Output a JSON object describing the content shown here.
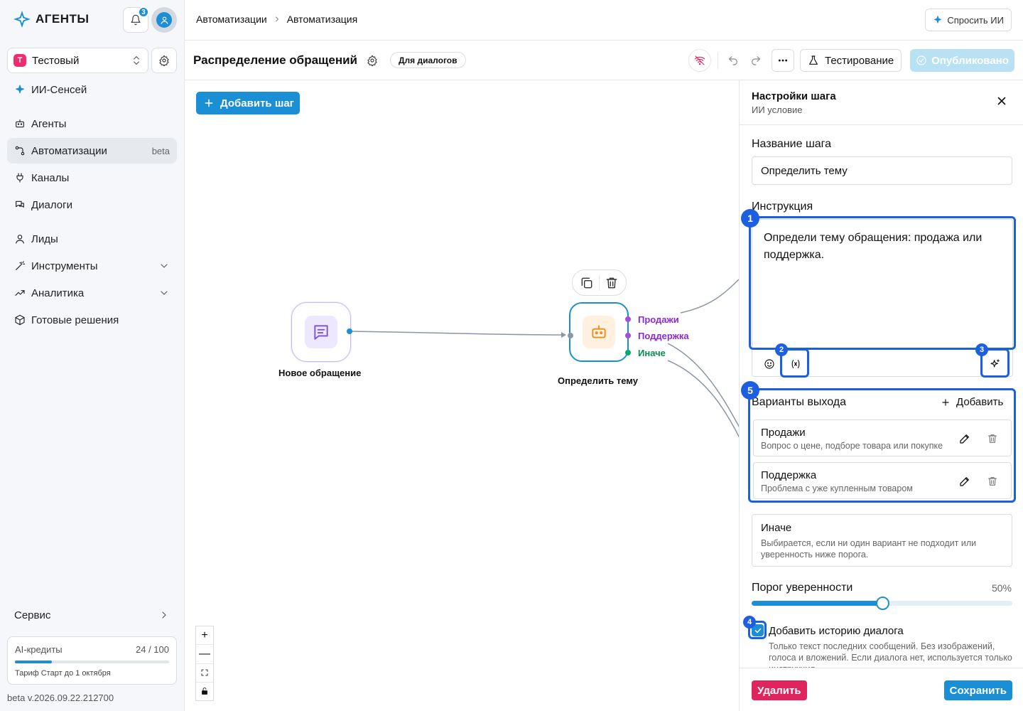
{
  "brand": {
    "name": "АГЕНТЫ",
    "accent": "#1a8fd6"
  },
  "header": {
    "notifications_count": "3"
  },
  "workspace": {
    "letter": "Т",
    "name": "Тестовый"
  },
  "sidebar": {
    "items": [
      {
        "label": "ИИ-Сенсей",
        "icon": "sparkle-icon"
      },
      {
        "label": "Агенты",
        "icon": "bot-icon"
      },
      {
        "label": "Автоматизации",
        "badge": "beta",
        "icon": "workflow-icon",
        "active": true
      },
      {
        "label": "Каналы",
        "icon": "plug-icon"
      },
      {
        "label": "Диалоги",
        "icon": "chats-icon"
      },
      {
        "label": "Лиды",
        "icon": "user-icon"
      },
      {
        "label": "Инструменты",
        "icon": "wand-icon"
      },
      {
        "label": "Аналитика",
        "icon": "chart-icon"
      },
      {
        "label": "Готовые решения",
        "icon": "package-icon"
      }
    ],
    "service": "Сервис",
    "credits": {
      "label": "AI-кредиты",
      "value": "24 / 100",
      "used_fraction": 0.24,
      "plan": "Тариф Старт до 1 октября"
    },
    "version": "beta v.2026.09.22.212700"
  },
  "breadcrumb": {
    "parent": "Автоматизации",
    "current": "Автоматизация"
  },
  "ask_ai": "Спросить ИИ",
  "flow": {
    "title": "Распределение обращений",
    "tag": "Для диалогов",
    "test_label": "Тестирование",
    "publish_label": "Опубликовано"
  },
  "canvas": {
    "add_step": "Добавить шаг",
    "nodes": [
      {
        "label": "Новое обращение",
        "type": "trigger"
      },
      {
        "label": "Определить тему",
        "type": "ai-condition"
      }
    ],
    "outputs": [
      {
        "label": "Продажи",
        "color": "#a64ddb"
      },
      {
        "label": "Поддержка",
        "color": "#a64ddb"
      },
      {
        "label": "Иначе",
        "color": "#0aa86b"
      }
    ]
  },
  "panel": {
    "title": "Настройки шага",
    "subtitle": "ИИ условие",
    "name_label": "Название шага",
    "name_value": "Определить тему",
    "instruction_label": "Инструкция",
    "instruction_value": "Определи тему обращения: продажа или поддержка.",
    "variants_label": "Варианты выхода",
    "add_label": "Добавить",
    "variants": [
      {
        "name": "Продажи",
        "desc": "Вопрос о цене, подборе товара или покупке"
      },
      {
        "name": "Поддержка",
        "desc": "Проблема с уже купленным товаром"
      }
    ],
    "else": {
      "name": "Иначе",
      "desc": "Выбирается, если ни один вариант не подходит или уверенность ниже порога."
    },
    "threshold_label": "Порог уверенности",
    "threshold_value": "50%",
    "threshold_fraction": 0.5,
    "history_label": "Добавить историю диалога",
    "history_desc": "Только текст последних сообщений. Без изображений, голоса и вложений. Если диалога нет, используется только инструкция.",
    "delete_label": "Удалить",
    "save_label": "Сохранить"
  },
  "annotations": [
    "1",
    "2",
    "3",
    "4",
    "5"
  ]
}
